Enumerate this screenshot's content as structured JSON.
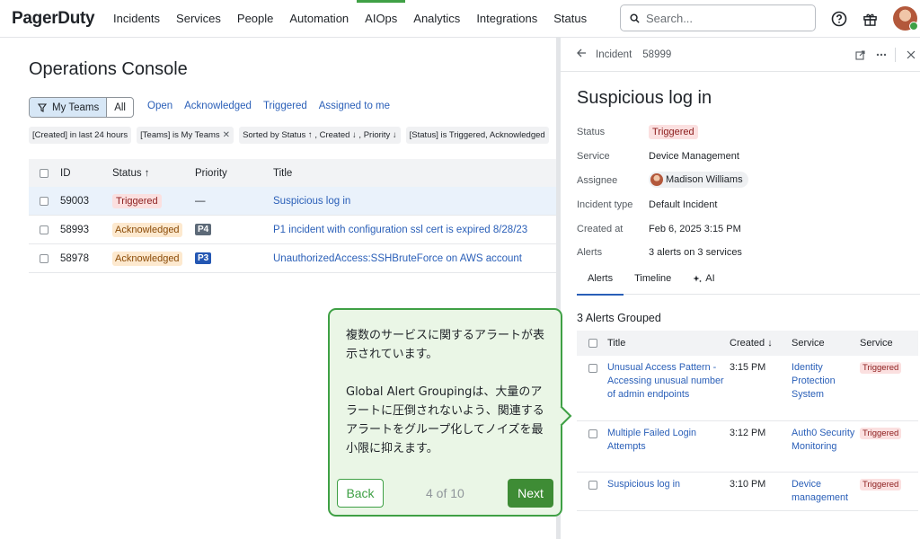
{
  "topbar": {
    "logo": "PagerDuty",
    "nav": [
      "Incidents",
      "Services",
      "People",
      "Automation",
      "AIOps",
      "Analytics",
      "Integrations",
      "Status"
    ],
    "active_nav": "AIOps",
    "search_placeholder": "Search...",
    "icons": [
      "help-icon",
      "gift-icon",
      "avatar"
    ]
  },
  "console": {
    "title": "Operations Console",
    "team_toggle": {
      "my_teams": "My Teams",
      "all": "All"
    },
    "quick_filters": [
      "Open",
      "Acknowledged",
      "Triggered",
      "Assigned to me"
    ],
    "chips": [
      "[Created] in last 24 hours",
      "[Teams] is My Teams",
      "Sorted by Status ↑ , Created ↓ , Priority ↓",
      "[Status] is Triggered, Acknowledged"
    ],
    "columns": {
      "id": "ID",
      "status": "Status ↑",
      "priority": "Priority",
      "title": "Title"
    },
    "rows": [
      {
        "id": "59003",
        "status": "Triggered",
        "priority": "—",
        "title": "Suspicious log in"
      },
      {
        "id": "58993",
        "status": "Acknowledged",
        "priority": "P4",
        "title": "P1 incident with configuration ssl cert is expired 8/28/23"
      },
      {
        "id": "58978",
        "status": "Acknowledged",
        "priority": "P3",
        "title": "UnauthorizedAccess:SSHBruteForce on AWS account"
      }
    ],
    "colors": {
      "p4": "#5d6a78",
      "p3": "#2457b3",
      "link": "#2a5fb8",
      "accent": "#3fa045"
    }
  },
  "incident": {
    "breadcrumb_label": "Incident",
    "number": "58999",
    "title": "Suspicious log in",
    "fields": {
      "status_label": "Status",
      "status_value": "Triggered",
      "service_label": "Service",
      "service_value": "Device Management",
      "assignee_label": "Assignee",
      "assignee_value": "Madison Williams",
      "type_label": "Incident type",
      "type_value": "Default Incident",
      "created_label": "Created at",
      "created_value": "Feb 6, 2025 3:15 PM",
      "alerts_label": "Alerts",
      "alerts_value": "3 alerts on 3 services"
    },
    "tabs": [
      "Alerts",
      "Timeline",
      "AI"
    ],
    "grouped_label": "3 Alerts Grouped",
    "alert_columns": {
      "title": "Title",
      "created": "Created ↓",
      "service": "Service",
      "status": "Service"
    },
    "alerts": [
      {
        "title": "Unusual Access Pattern - Accessing unusual number of admin endpoints",
        "created": "3:15 PM",
        "service": "Identity Protection System",
        "status": "Triggered"
      },
      {
        "title": "Multiple Failed Login Attempts",
        "created": "3:12 PM",
        "service": "Auth0 Security Monitoring",
        "status": "Triggered"
      },
      {
        "title": "Suspicious log in",
        "created": "3:10 PM",
        "service": "Device management",
        "status": "Triggered"
      }
    ]
  },
  "tour": {
    "para1": "複数のサービスに関するアラートが表示されています。",
    "para2": "Global Alert Groupingは、大量のアラートに圧倒されないよう、関連するアラートをグループ化してノイズを最小限に抑えます。",
    "back_label": "Back",
    "progress": "4 of 10",
    "next_label": "Next"
  }
}
